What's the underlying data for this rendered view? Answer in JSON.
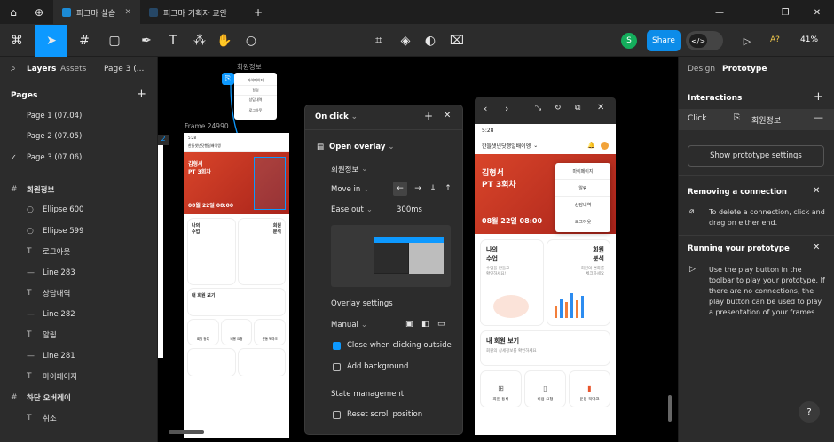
{
  "tabs": [
    {
      "label": "피그마 실습",
      "active": true
    },
    {
      "label": "피그마 기획자 교안",
      "active": false
    }
  ],
  "toolbar": {
    "avatar": "S",
    "share": "Share",
    "font_hint": "A?",
    "zoom": "41%"
  },
  "left_panel": {
    "tab_layers": "Layers",
    "tab_assets": "Assets",
    "page_selector": "Page 3 (...",
    "pages_title": "Pages",
    "pages": [
      {
        "label": "Page 1 (07.04)",
        "checked": false
      },
      {
        "label": "Page 2 (07.05)",
        "checked": false
      },
      {
        "label": "Page 3 (07.06)",
        "checked": true
      }
    ],
    "layers": [
      {
        "label": "회원정보",
        "icon": "frame-icon",
        "indent": 0
      },
      {
        "label": "Ellipse 600",
        "icon": "ellipse-icon",
        "indent": 1
      },
      {
        "label": "Ellipse 599",
        "icon": "ellipse-icon",
        "indent": 1
      },
      {
        "label": "로그아웃",
        "icon": "text-icon",
        "indent": 1
      },
      {
        "label": "Line 283",
        "icon": "line-icon",
        "indent": 1
      },
      {
        "label": "상담내역",
        "icon": "text-icon",
        "indent": 1
      },
      {
        "label": "Line 282",
        "icon": "line-icon",
        "indent": 1
      },
      {
        "label": "알림",
        "icon": "text-icon",
        "indent": 1
      },
      {
        "label": "Line 281",
        "icon": "line-icon",
        "indent": 1
      },
      {
        "label": "마이페이지",
        "icon": "text-icon",
        "indent": 1
      },
      {
        "label": "하단 오버레이",
        "icon": "frame-icon",
        "indent": 0
      },
      {
        "label": "취소",
        "icon": "text-icon",
        "indent": 1
      }
    ]
  },
  "canvas": {
    "overlay_frame_label": "회원정보",
    "frame_label": "Frame 24990",
    "flow_badge": "2",
    "overlay_items": [
      "마이페이지",
      "알림",
      "상담내역",
      "로그아웃"
    ]
  },
  "popover": {
    "title": "On click",
    "action": "Open overlay",
    "destination": "회원정보",
    "animation": "Move in",
    "easing": "Ease out",
    "duration": "300ms",
    "overlay_settings": "Overlay settings",
    "position": "Manual",
    "close_outside": "Close when clicking outside",
    "close_outside_checked": true,
    "add_background": "Add background",
    "add_background_checked": false,
    "state_management": "State management",
    "reset_scroll": "Reset scroll position",
    "reset_scroll_checked": false
  },
  "app": {
    "time": "5:28",
    "location": "한들샛년닷행일배이엥",
    "menu": [
      "마이페이지",
      "알림",
      "상담내역",
      "로그아웃"
    ],
    "hero_name": "김형서",
    "hero_sub": "PT 3회차",
    "hero_date": "08월 22일 08:00",
    "card1_title": "나의\n수업",
    "card1_desc": "수업을 만들고\n확인하세요!",
    "card2_title": "회원\n분석",
    "card2_desc": "회원의 변화를\n체크하세요",
    "card3_title": "내 회원 보기",
    "card3_desc": "회원의 상세정보를 확인하세요",
    "quick": [
      "회원 등록",
      "비용 요청",
      "운동 북마크"
    ]
  },
  "right_panel": {
    "tab_design": "Design",
    "tab_prototype": "Prototype",
    "interactions": "Interactions",
    "trigger": "Click",
    "target": "회원정보",
    "show_settings": "Show prototype settings",
    "removing_title": "Removing a connection",
    "removing_text": "To delete a connection, click and drag on either end.",
    "running_title": "Running your prototype",
    "running_text": "Use the play button in the toolbar to play your prototype. If there are no connections, the play button can be used to play a presentation of your frames.",
    "help": "?"
  },
  "colors": {
    "accent": "#0d99ff",
    "share": "#0c8ce9",
    "hero": "#d23b22",
    "avatar": "#14ae5c"
  }
}
